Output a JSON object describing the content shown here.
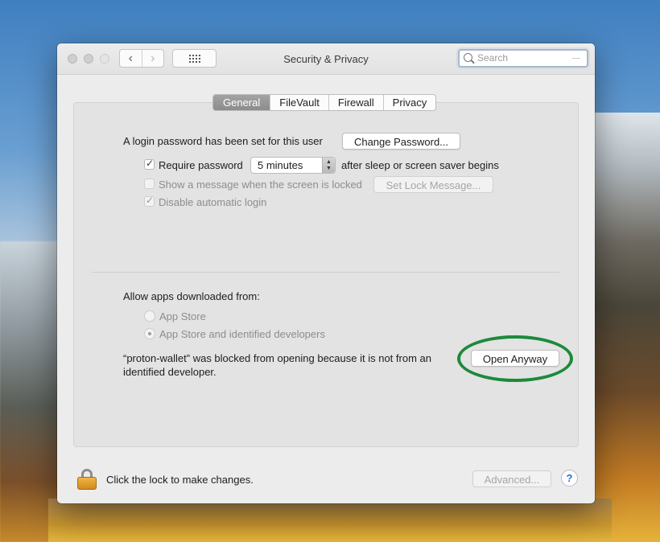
{
  "window": {
    "title": "Security & Privacy",
    "search_placeholder": "Search"
  },
  "tabs": [
    {
      "label": "General",
      "active": true
    },
    {
      "label": "FileVault",
      "active": false
    },
    {
      "label": "Firewall",
      "active": false
    },
    {
      "label": "Privacy",
      "active": false
    }
  ],
  "general": {
    "login_password_text": "A login password has been set for this user",
    "change_password_label": "Change Password...",
    "require_password": {
      "label": "Require password",
      "checked": true
    },
    "require_password_delay": "5 minutes",
    "after_sleep_text": "after sleep or screen saver begins",
    "show_message": {
      "label": "Show a message when the screen is locked",
      "checked": false
    },
    "set_lock_message_label": "Set Lock Message...",
    "disable_auto_login": {
      "label": "Disable automatic login",
      "checked": true
    }
  },
  "gatekeeper": {
    "allow_apps_text": "Allow apps downloaded from:",
    "options": [
      {
        "label": "App Store",
        "selected": false
      },
      {
        "label": "App Store and identified developers",
        "selected": true
      }
    ],
    "blocked_message_line1": "“proton-wallet” was blocked from opening because it is not from an",
    "blocked_message_line2": "identified developer.",
    "open_anyway_label": "Open Anyway",
    "highlight_color": "#1c8a3a"
  },
  "footer": {
    "lock_text": "Click the lock to make changes.",
    "advanced_label": "Advanced...",
    "help_label": "?"
  }
}
